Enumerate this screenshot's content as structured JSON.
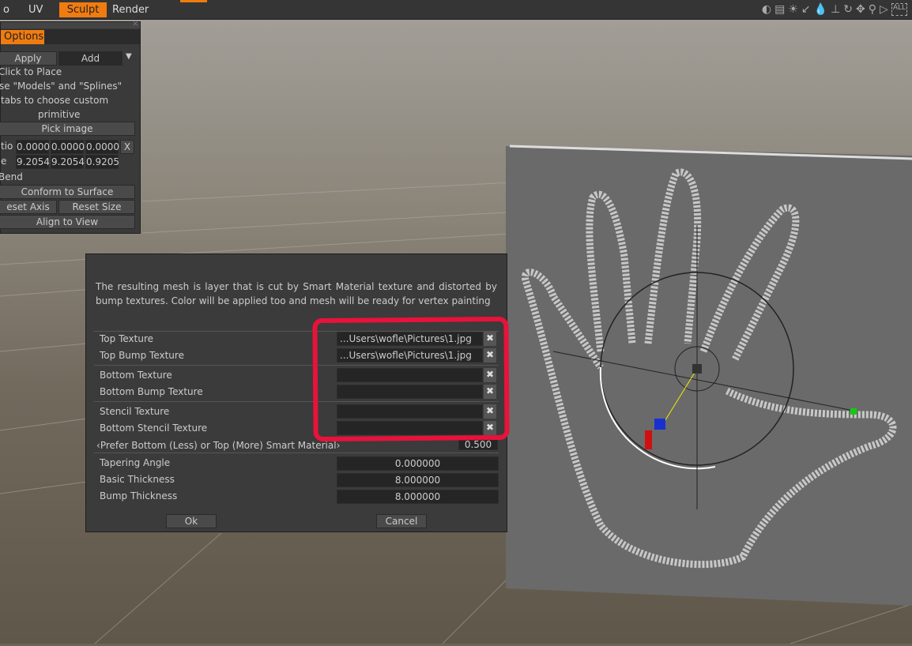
{
  "topbar": {
    "tabs": [
      {
        "label": "o"
      },
      {
        "label": "UV"
      },
      {
        "label": "Sculpt",
        "active": true
      },
      {
        "label": "Render"
      }
    ],
    "icons": [
      "contrast-icon",
      "image-icon",
      "light-icon",
      "light-direction-icon",
      "drop-icon",
      "rotate-base-icon",
      "rotate-icon",
      "move-icon",
      "zoom-icon",
      "play-triangle-icon",
      "fit-all-icon"
    ],
    "fit_all_label": "ALL",
    "accent": "#f07c10"
  },
  "options": {
    "tab": "Options",
    "apply": "Apply",
    "add": "Add",
    "hint": [
      "Click to Place",
      "se \"Models\" and \"Splines\"",
      "tabs to choose custom",
      "primitive"
    ],
    "pick_image": "Pick image",
    "ratio_label": "tio",
    "ratio": [
      "0.0000",
      "0.0000",
      "0.0000"
    ],
    "ratio_x": "X",
    "scale_label": "e",
    "scale": [
      "9.2054",
      "9.2054",
      "0.9205"
    ],
    "bend": "Bend",
    "conform": "Conform to Surface",
    "reset_axis": "eset Axis",
    "reset_size": "Reset Size",
    "align": "Align to View"
  },
  "dialog": {
    "description": "The resulting mesh is layer that is cut by Smart Material texture and distorted by bump textures. Color will be applied too and mesh will be ready for vertex painting",
    "textures": [
      {
        "label": "Top Texture",
        "value": "...Users\\wofle\\Pictures\\1.jpg"
      },
      {
        "label": "Top Bump Texture",
        "value": "...Users\\wofle\\Pictures\\1.jpg"
      },
      {
        "label": "Bottom Texture",
        "value": ""
      },
      {
        "label": "Bottom Bump Texture",
        "value": ""
      },
      {
        "label": "Stencil Texture",
        "value": ""
      },
      {
        "label": "Bottom Stencil Texture",
        "value": ""
      }
    ],
    "clear": "✖",
    "prefer_label": "Prefer Bottom (Less) or Top (More) Smart Material",
    "prefer_value": "0.500",
    "params": [
      {
        "label": "Tapering Angle",
        "value": "0.000000"
      },
      {
        "label": "Basic Thickness",
        "value": "8.000000"
      },
      {
        "label": "Bump Thickness",
        "value": "8.000000"
      }
    ],
    "ok": "Ok",
    "cancel": "Cancel",
    "highlight_color": "#e8123a"
  }
}
